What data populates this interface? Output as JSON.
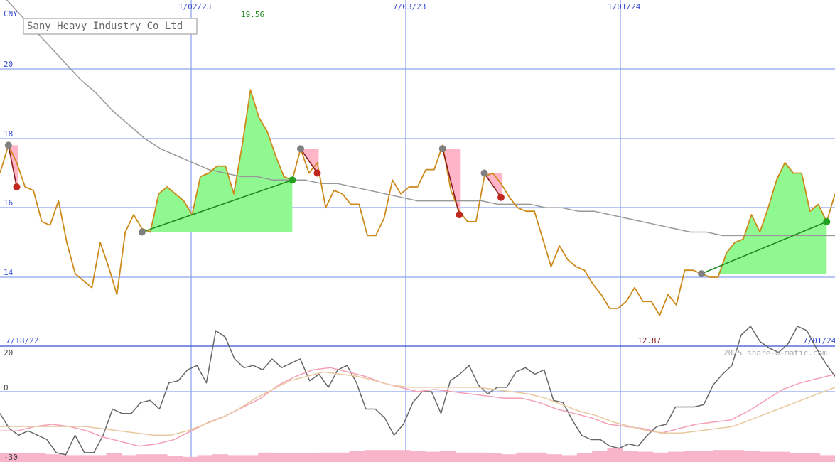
{
  "chart_data": [
    {
      "type": "line",
      "title": "Sany Heavy Industry Co Ltd",
      "currency_label": "CNY",
      "ylim": [
        12,
        22.2
      ],
      "y_ticks": [
        14,
        16,
        18,
        20
      ],
      "x_date_labels": [
        "7/18/22",
        "1/02/23",
        "7/03/23",
        "1/01/24",
        "7/01/24"
      ],
      "x_gridline_dates": [
        "1/02/23",
        "7/03/23",
        "1/01/24"
      ],
      "high_label": "19.56",
      "low_label": "12.87",
      "price_series": {
        "name": "",
        "color": "#cc8a1a",
        "values": [
          17.0,
          17.8,
          17.3,
          16.6,
          16.5,
          15.6,
          15.5,
          16.2,
          15.0,
          14.1,
          13.9,
          13.7,
          15.0,
          14.3,
          13.5,
          15.3,
          15.8,
          15.4,
          15.3,
          16.4,
          16.6,
          16.4,
          16.2,
          15.8,
          16.9,
          17.0,
          17.2,
          17.2,
          16.4,
          17.8,
          19.4,
          18.6,
          18.2,
          17.5,
          16.9,
          16.8,
          17.7,
          17.0,
          17.3,
          16.0,
          16.5,
          16.4,
          16.1,
          16.1,
          15.2,
          15.2,
          15.7,
          16.8,
          16.4,
          16.6,
          16.6,
          17.1,
          17.1,
          17.8,
          16.5,
          15.9,
          15.6,
          15.6,
          16.9,
          17.0,
          16.7,
          16.3,
          16.0,
          15.9,
          15.9,
          15.1,
          14.3,
          14.9,
          14.5,
          14.3,
          14.2,
          13.8,
          13.5,
          13.1,
          13.1,
          13.3,
          13.7,
          13.3,
          13.3,
          12.9,
          13.5,
          13.2,
          14.2,
          14.2,
          14.1,
          14.0,
          14.0,
          14.7,
          15.0,
          15.1,
          15.8,
          15.3,
          16.0,
          16.8,
          17.3,
          17.0,
          17.0,
          15.9,
          16.1,
          15.6,
          16.4
        ]
      },
      "moving_average": {
        "name": "",
        "color": "#999999",
        "values": [
          22.2,
          21.7,
          21.2,
          20.7,
          20.2,
          19.7,
          19.3,
          18.8,
          18.4,
          18.0,
          17.7,
          17.5,
          17.3,
          17.1,
          17.0,
          16.9,
          16.9,
          16.8,
          16.8,
          16.8,
          16.7,
          16.7,
          16.6,
          16.5,
          16.4,
          16.3,
          16.2,
          16.2,
          16.2,
          16.2,
          16.2,
          16.1,
          16.1,
          16.1,
          16.0,
          16.0,
          15.9,
          15.9,
          15.8,
          15.7,
          15.6,
          15.5,
          15.4,
          15.3,
          15.3,
          15.2,
          15.2,
          15.2,
          15.2,
          15.2,
          15.2,
          15.2,
          15.2
        ]
      },
      "signals": [
        {
          "kind": "sell",
          "from_index": 1,
          "from_value": 17.8,
          "to_index": 2,
          "to_value": 16.6
        },
        {
          "kind": "buy",
          "from_index": 17,
          "from_value": 15.3,
          "to_index": 35,
          "to_value": 16.8
        },
        {
          "kind": "sell",
          "from_index": 36,
          "from_value": 17.7,
          "to_index": 38,
          "to_value": 17.0
        },
        {
          "kind": "sell",
          "from_index": 53,
          "from_value": 17.7,
          "to_index": 55,
          "to_value": 15.8
        },
        {
          "kind": "sell",
          "from_index": 58,
          "from_value": 17.0,
          "to_index": 60,
          "to_value": 16.3
        },
        {
          "kind": "buy",
          "from_index": 84,
          "from_value": 14.1,
          "to_index": 99,
          "to_value": 15.6
        }
      ]
    },
    {
      "type": "line",
      "title": "",
      "ylim": [
        -30,
        25
      ],
      "y_ticks": [
        20,
        0,
        -30
      ],
      "zero_line": 0,
      "series": [
        {
          "name": "",
          "color": "#666666",
          "values": [
            -10,
            -17,
            -20,
            -18,
            -20,
            -22,
            -28,
            -29,
            -20,
            -28,
            -28,
            -20,
            -8,
            -10,
            -10,
            -5,
            -4,
            -8,
            4,
            5,
            10,
            12,
            4,
            28,
            25,
            15,
            11,
            12,
            10,
            15,
            11,
            13,
            15,
            5,
            8,
            2,
            10,
            12,
            4,
            -8,
            -8,
            -12,
            -20,
            -15,
            -5,
            0,
            0,
            -10,
            5,
            8,
            12,
            3,
            -1,
            2,
            2,
            9,
            11,
            8,
            10,
            -4,
            -5,
            -13,
            -20,
            -22,
            -22,
            -25,
            -26,
            -24,
            -25,
            -20,
            -16,
            -15,
            -7,
            -7,
            -7,
            -6,
            3,
            8,
            12,
            26,
            30,
            23,
            20,
            18,
            22,
            30,
            28,
            20,
            13,
            7
          ]
        },
        {
          "name": "",
          "color": "#f4a0b4",
          "values": [
            -18,
            -18,
            -16,
            -15,
            -16,
            -18,
            -21,
            -23,
            -25,
            -24,
            -22,
            -18,
            -14,
            -11,
            -7,
            -3,
            3,
            7,
            10,
            11,
            9,
            7,
            4,
            2,
            0,
            1,
            0,
            -1,
            -2,
            -3,
            -3,
            -5,
            -8,
            -10,
            -12,
            -15,
            -16,
            -17,
            -19,
            -17,
            -15,
            -14,
            -13,
            -9,
            -4,
            1,
            4,
            6,
            8
          ]
        },
        {
          "name": "",
          "color": "#e8c9a0",
          "values": [
            -16,
            -16,
            -16,
            -16,
            -16,
            -16,
            -17,
            -18,
            -19,
            -20,
            -20,
            -18,
            -15,
            -12,
            -8,
            -3,
            1,
            5,
            7,
            9,
            8,
            7,
            5,
            3,
            2,
            2,
            2,
            2,
            2,
            1,
            0,
            -1,
            -3,
            -6,
            -9,
            -11,
            -14,
            -16,
            -18,
            -19,
            -19,
            -18,
            -17,
            -16,
            -13,
            -10,
            -7,
            -4,
            -1,
            2
          ]
        }
      ],
      "watermark": "2025 share-o-matic.com"
    },
    {
      "type": "bar",
      "title": "",
      "color": "#f8b4c8",
      "values": [
        1.0,
        1.0,
        1.0,
        0.9,
        0.8,
        0.8,
        0.8,
        1.0,
        0.8,
        0.9,
        0.9,
        0.7,
        0.6,
        0.8,
        0.9,
        0.8,
        0.8,
        1.1,
        1.0,
        1.0,
        1.0,
        1.1,
        1.1,
        1.3,
        1.4,
        1.4,
        1.4,
        1.3,
        1.2,
        1.3,
        1.1,
        1.1,
        1.0,
        0.9,
        1.1,
        1.1,
        0.9,
        0.8,
        1.0,
        1.3,
        1.6,
        1.3,
        1.2,
        1.1,
        1.2,
        1.3,
        1.3,
        1.4,
        1.4,
        1.3,
        1.2,
        1.2,
        1.0,
        1.0,
        0.8
      ]
    }
  ]
}
